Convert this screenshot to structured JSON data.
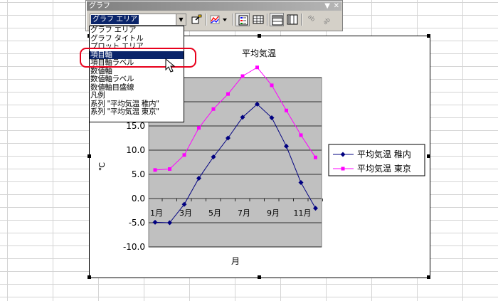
{
  "toolbar": {
    "title": "グラフ",
    "menu_arrow": "▼",
    "close_glyph": "✕",
    "combo_value": "グラフ エリア",
    "combo_arrow": "▼"
  },
  "dropdown": {
    "items": [
      "グラフ エリア",
      "グラフ タイトル",
      "プロット エリア",
      "項目軸",
      "項目軸ラベル",
      "数値軸",
      "数値軸ラベル",
      "数値軸目盛線",
      "凡例",
      "系列 \"平均気温 稚内\"",
      "系列 \"平均気温 東京\""
    ],
    "selected_index": 3
  },
  "colors": {
    "plot_background": "#c0c0c0",
    "series_wakkanai": "#000080",
    "series_tokyo": "#ff00ff",
    "highlight": "#e8001c",
    "selection": "#0a246a"
  },
  "chart_data": {
    "type": "line",
    "title": "平均気温",
    "xlabel": "月",
    "ylabel": "℃",
    "ylim": [
      -10,
      25
    ],
    "y_ticks": [
      "-10.0",
      "-5.0",
      "0.0",
      "5.0",
      "10.0",
      "15.0"
    ],
    "x_tick_labels": [
      "1月",
      "3月",
      "5月",
      "7月",
      "9月",
      "11月"
    ],
    "x": [
      1,
      2,
      3,
      4,
      5,
      6,
      7,
      8,
      9,
      10,
      11,
      12
    ],
    "legend_position": "right",
    "series": [
      {
        "name": "平均気温 稚内",
        "values": [
          -4.9,
          -5.0,
          -1.2,
          4.2,
          8.6,
          12.5,
          16.8,
          19.5,
          16.7,
          10.8,
          3.3,
          -2.0
        ],
        "color": "#000080",
        "marker": "diamond"
      },
      {
        "name": "平均気温 東京",
        "values": [
          5.9,
          6.1,
          9.0,
          14.6,
          18.5,
          21.6,
          25.3,
          27.1,
          23.4,
          18.2,
          13.1,
          8.5
        ],
        "color": "#ff00ff",
        "marker": "square"
      }
    ]
  }
}
